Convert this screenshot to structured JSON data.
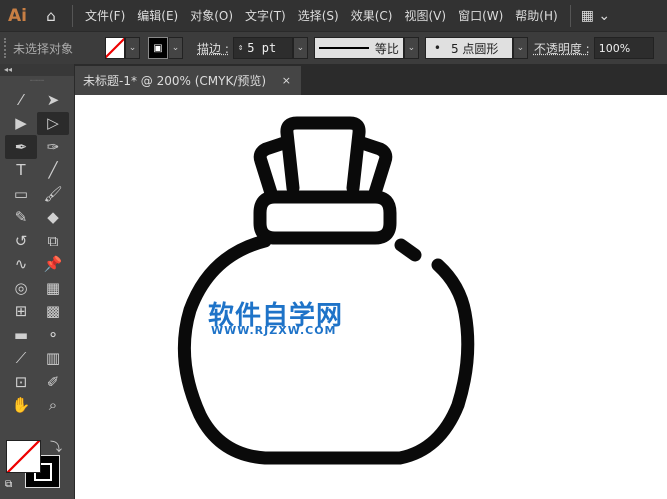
{
  "app": {
    "logo": "Ai"
  },
  "menu": [
    "文件(F)",
    "编辑(E)",
    "对象(O)",
    "文字(T)",
    "选择(S)",
    "效果(C)",
    "视图(V)",
    "窗口(W)",
    "帮助(H)"
  ],
  "control": {
    "selection": "未选择对象",
    "stroke_label": "描边 :",
    "stroke_value": "5 pt",
    "profile": "等比",
    "brush": "5 点圆形",
    "opacity_label": "不透明度 :",
    "opacity_value": "100%"
  },
  "document_tab": {
    "title": "未标题-1* @ 200% (CMYK/预览)",
    "close": "×"
  },
  "watermark": {
    "title": "软件自学网",
    "url": "WWW.RJZXW.COM"
  },
  "colors": {
    "stroke": "#0a0a0a",
    "watermark": "#1e73c8"
  }
}
